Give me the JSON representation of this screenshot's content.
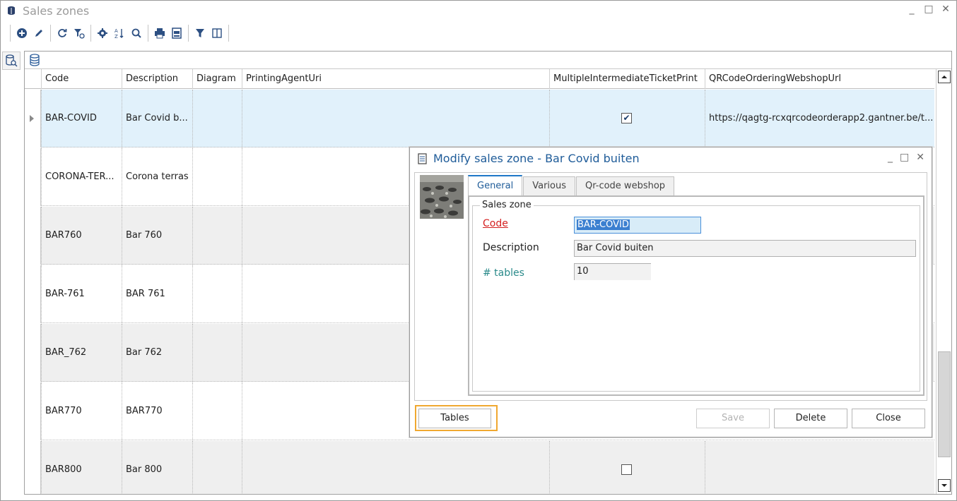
{
  "window": {
    "title": "Sales zones",
    "controls": [
      "_",
      "□",
      "✕"
    ]
  },
  "toolbar": {
    "buttons": [
      "add-icon",
      "edit-icon",
      "refresh-icon",
      "clear-filter-icon",
      "settings-icon",
      "sort-az-icon",
      "search-icon",
      "print-icon",
      "print-preview-icon",
      "filter-icon",
      "columns-icon"
    ]
  },
  "grid": {
    "columns": [
      "Code",
      "Description",
      "Diagram",
      "PrintingAgentUri",
      "MultipleIntermediateTicketPrint",
      "QRCodeOrderingWebshopUrl"
    ],
    "rows": [
      {
        "code": "BAR-COVID",
        "description": "Bar Covid b...",
        "multiple_print": true,
        "url": "https://qagtg-rcxqrcodeorderapp2.gantner.be/t..."
      },
      {
        "code": "CORONA-TER...",
        "description": "Corona terras",
        "multiple_print": null,
        "url": ""
      },
      {
        "code": "BAR760",
        "description": "Bar 760",
        "multiple_print": null,
        "url": ""
      },
      {
        "code": "BAR-761",
        "description": "BAR 761",
        "multiple_print": null,
        "url": ""
      },
      {
        "code": "BAR_762",
        "description": "Bar 762",
        "multiple_print": null,
        "url": ""
      },
      {
        "code": "BAR770",
        "description": "BAR770",
        "multiple_print": null,
        "url": ""
      },
      {
        "code": "BAR800",
        "description": "Bar 800",
        "multiple_print": false,
        "url": ""
      }
    ]
  },
  "dialog": {
    "title": "Modify sales zone - Bar Covid buiten",
    "tabs": [
      "General",
      "Various",
      "Qr-code webshop"
    ],
    "active_tab": "General",
    "group_title": "Sales zone",
    "fields": {
      "code_label": "Code",
      "code_value": "BAR-COVID",
      "description_label": "Description",
      "description_value": "Bar Covid buiten",
      "tables_label": "# tables",
      "tables_value": "10"
    },
    "buttons": {
      "tables": "Tables",
      "save": "Save",
      "delete": "Delete",
      "close": "Close"
    }
  },
  "colors": {
    "selected_row": "#e1f1fb",
    "accent_blue": "#1f5c99",
    "required_red": "#d42020",
    "teal_label": "#2a8a8a",
    "focus_orange": "#f0a830"
  }
}
